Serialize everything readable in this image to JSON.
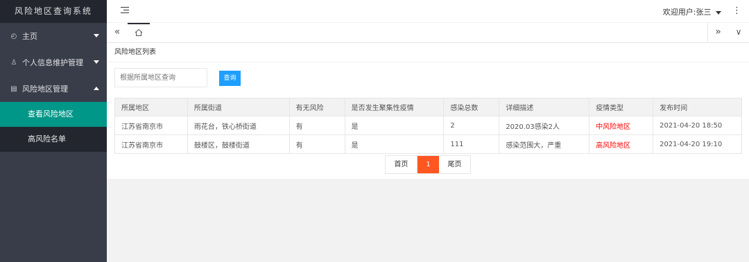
{
  "app": {
    "title": "风险地区查询系统"
  },
  "sidebar": {
    "items": [
      {
        "label": "主页",
        "icon": "dashboard-icon"
      },
      {
        "label": "个人信息维护管理",
        "icon": "user-icon"
      },
      {
        "label": "风险地区管理",
        "icon": "document-icon"
      }
    ],
    "subitems": [
      {
        "label": "查看风险地区",
        "active": true
      },
      {
        "label": "高风险名单",
        "active": false
      }
    ]
  },
  "header": {
    "user_label": "欢迎用户:张三"
  },
  "tabs": {
    "home_icon": "home-icon"
  },
  "card": {
    "title": "风险地区列表",
    "search_placeholder": "根据所属地区查询",
    "search_button": "查询"
  },
  "table": {
    "columns": [
      "所属地区",
      "所属街道",
      "有无风险",
      "是否发生聚集性疫情",
      "感染总数",
      "详细描述",
      "疫情类型",
      "发布时间"
    ],
    "rows": [
      [
        "江苏省南京市",
        "雨花台，铁心桥街道",
        "有",
        "是",
        "2",
        "2020.03感染2人",
        "中风险地区",
        "2021-04-20 18:50"
      ],
      [
        "江苏省南京市",
        "鼓楼区，鼓楼街道",
        "有",
        "是",
        "111",
        "感染范围大，严重",
        "高风险地区",
        "2021-04-20 19:10"
      ]
    ]
  },
  "pagination": {
    "first": "首页",
    "current": "1",
    "last": "尾页"
  },
  "colors": {
    "sidebar": "#393d49",
    "active": "#009688",
    "button": "#1e9fff",
    "page_current": "#ff5722",
    "risk": "#ff0000"
  }
}
